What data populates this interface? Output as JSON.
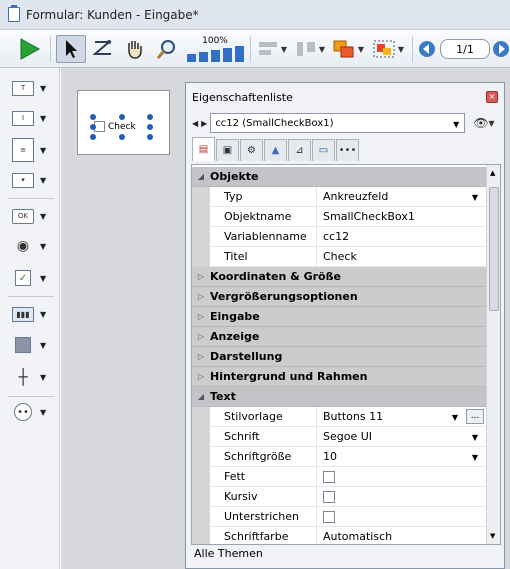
{
  "window": {
    "title": "Formular: Kunden -  Eingabe*"
  },
  "toolbar": {
    "zoom_label": "100%",
    "page_indicator": "1/1"
  },
  "canvas_object": {
    "label": "Check"
  },
  "panel": {
    "title": "Eigenschaftenliste",
    "object_selector": "cc12 (SmallCheckBox1)",
    "footer": "Alle Themen",
    "close_glyph": "×"
  },
  "categories": {
    "objekte": "Objekte",
    "koordinaten": "Koordinaten & Größe",
    "vergroesserung": "Vergrößerungsoptionen",
    "eingabe": "Eingabe",
    "anzeige": "Anzeige",
    "darstellung": "Darstellung",
    "hintergrund": "Hintergrund und Rahmen",
    "text": "Text"
  },
  "objekte_props": [
    {
      "name": "Typ",
      "value": "Ankreuzfeld"
    },
    {
      "name": "Objektname",
      "value": "SmallCheckBox1"
    },
    {
      "name": "Variablenname",
      "value": "cc12"
    },
    {
      "name": "Titel",
      "value": "Check"
    }
  ],
  "text_props": [
    {
      "name": "Stilvorlage",
      "value": "Buttons 11"
    },
    {
      "name": "Schrift",
      "value": "Segoe UI"
    },
    {
      "name": "Schriftgröße",
      "value": "10"
    },
    {
      "name": "Fett",
      "value": ""
    },
    {
      "name": "Kursiv",
      "value": ""
    },
    {
      "name": "Unterstrichen",
      "value": ""
    },
    {
      "name": "Schriftfarbe",
      "value": "Automatisch"
    }
  ],
  "browse_glyph": "...",
  "colors": {
    "accent": "#1f5fb6",
    "category_bg": "#cccccc"
  }
}
